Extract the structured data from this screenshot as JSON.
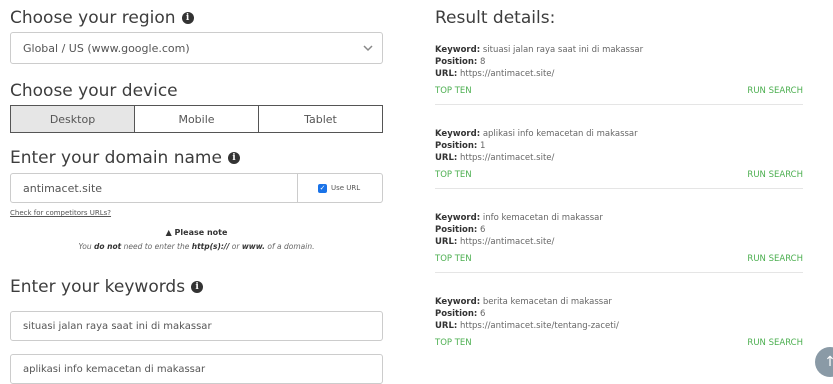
{
  "region": {
    "title": "Choose your region",
    "selected": "Global / US (www.google.com)"
  },
  "device": {
    "title": "Choose your device",
    "options": [
      "Desktop",
      "Mobile",
      "Tablet"
    ],
    "active": "Desktop"
  },
  "domain": {
    "title": "Enter your domain name",
    "value": "antimacet.site",
    "use_url_label": "Use URL",
    "competitors_link": "Check for competitors URLs?",
    "note_title": "Please note",
    "note_prefix": "You ",
    "note_do_not": "do not",
    "note_mid": " need to enter the ",
    "note_http": "http(s)://",
    "note_or": " or ",
    "note_www": "www.",
    "note_suffix": " of a domain."
  },
  "keywords": {
    "title": "Enter your keywords",
    "items": [
      "situasi jalan raya saat ini di makassar",
      "aplikasi info kemacetan di makassar"
    ]
  },
  "results": {
    "title": "Result details:",
    "keyword_label": "Keyword:",
    "position_label": "Position:",
    "url_label": "URL:",
    "top_ten_label": "TOP TEN",
    "run_search_label": "RUN SEARCH",
    "items": [
      {
        "keyword": "situasi jalan raya saat ini di makassar",
        "position": "8",
        "url": "https://antimacet.site/"
      },
      {
        "keyword": "aplikasi info kemacetan di makassar",
        "position": "1",
        "url": "https://antimacet.site/"
      },
      {
        "keyword": "info kemacetan di makassar",
        "position": "6",
        "url": "https://antimacet.site/"
      },
      {
        "keyword": "berita kemacetan di makassar",
        "position": "6",
        "url": "https://antimacet.site/tentang-zaceti/"
      }
    ]
  },
  "icons": {
    "info": "info-icon",
    "chevron": "chevron-down-icon",
    "checkbox": "checkbox-checked-icon",
    "warning": "warning-icon",
    "scroll_top": "arrow-up-icon"
  },
  "colors": {
    "action_green": "#4caf50",
    "checkbox_blue": "#1a73e8"
  }
}
